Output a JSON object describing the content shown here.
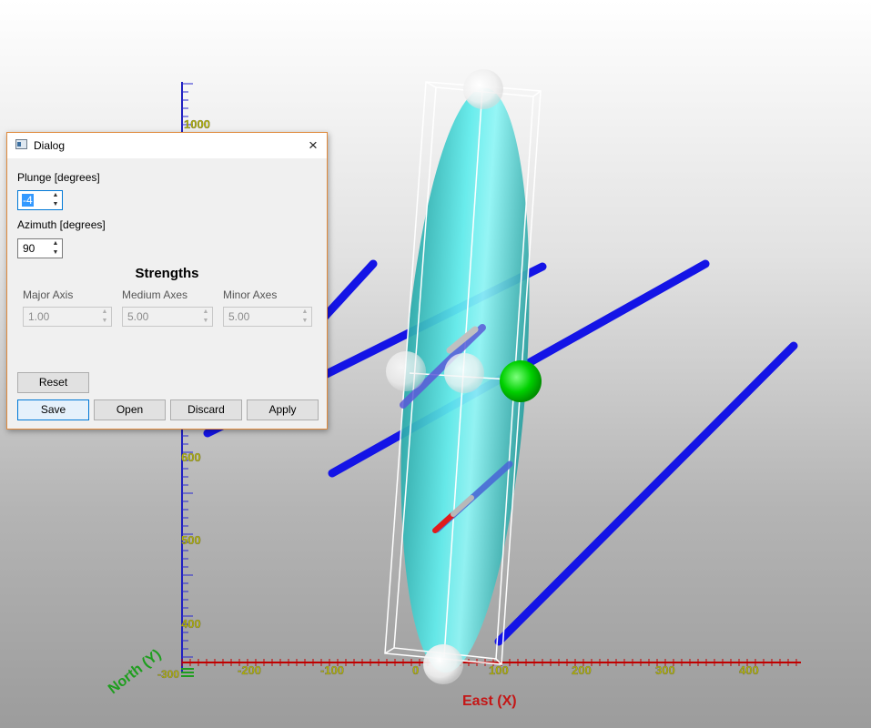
{
  "scene": {
    "y_axis_ticks": [
      "1000",
      "600",
      "500",
      "400"
    ],
    "x_axis_ticks": [
      "-200",
      "-100",
      "0",
      "100",
      "200",
      "300",
      "400"
    ],
    "x_axis_origin_label": "-300",
    "x_axis_title": "East (X)",
    "y_axis_title": "North (Y)",
    "colors": {
      "x_axis": "#c00000",
      "y_axis": "#2020c0",
      "tick_label": "#b5b500",
      "y_title": "#1e9e1e",
      "ellipsoid": "#3fd6d6",
      "drillhole": "#1414e6",
      "handle_green": "#00cc00"
    }
  },
  "dialog": {
    "title": "Dialog",
    "close_icon": "×",
    "plunge_label": "Plunge [degrees]",
    "plunge_value": "-4",
    "azimuth_label": "Azimuth [degrees]",
    "azimuth_value": "90",
    "strengths_title": "Strengths",
    "major_label": "Major Axis",
    "medium_label": "Medium Axes",
    "minor_label": "Minor Axes",
    "major_value": "1.00",
    "medium_value": "5.00",
    "minor_value": "5.00",
    "reset_label": "Reset",
    "save_label": "Save",
    "open_label": "Open",
    "discard_label": "Discard",
    "apply_label": "Apply",
    "up_arrow": "▲",
    "down_arrow": "▼"
  }
}
